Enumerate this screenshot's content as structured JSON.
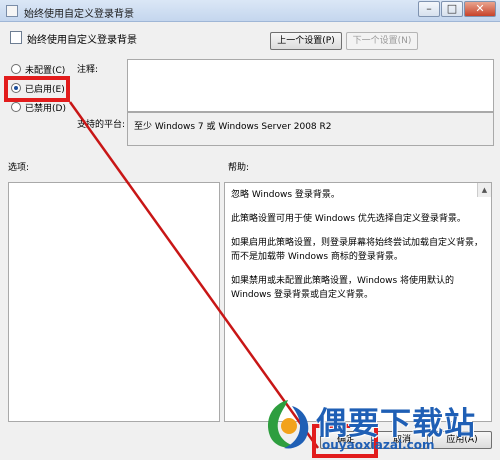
{
  "window": {
    "title": "始终使用自定义登录背景"
  },
  "header": {
    "policy_title": "始终使用自定义登录背景",
    "prev_button": "上一个设置(P)",
    "next_button": "下一个设置(N)"
  },
  "state": {
    "options": [
      {
        "label": "未配置(C)",
        "checked": false
      },
      {
        "label": "已启用(E)",
        "checked": true
      },
      {
        "label": "已禁用(D)",
        "checked": false
      }
    ]
  },
  "comment": {
    "label": "注释:"
  },
  "platform": {
    "label": "支持的平台:",
    "value": "至少 Windows 7 或 Windows Server 2008 R2"
  },
  "options_panel": {
    "label": "选项:"
  },
  "help_panel": {
    "label": "帮助:",
    "paragraphs": [
      "忽略 Windows 登录背景。",
      "此策略设置可用于使 Windows 优先选择自定义登录背景。",
      "如果启用此策略设置，则登录屏幕将始终尝试加载自定义背景，而不是加载带 Windows 商标的登录背景。",
      "如果禁用或未配置此策略设置，Windows 将使用默认的 Windows 登录背景或自定义背景。"
    ]
  },
  "footer": {
    "ok_button": "确定",
    "cancel_button": "取消",
    "apply_button": "应用(A)"
  },
  "watermark": {
    "title": "偶要下载站",
    "url": "ouyaoxiazai.com"
  },
  "colors": {
    "annotation": "#e21c1c",
    "watermark": "#1f5fb5"
  }
}
